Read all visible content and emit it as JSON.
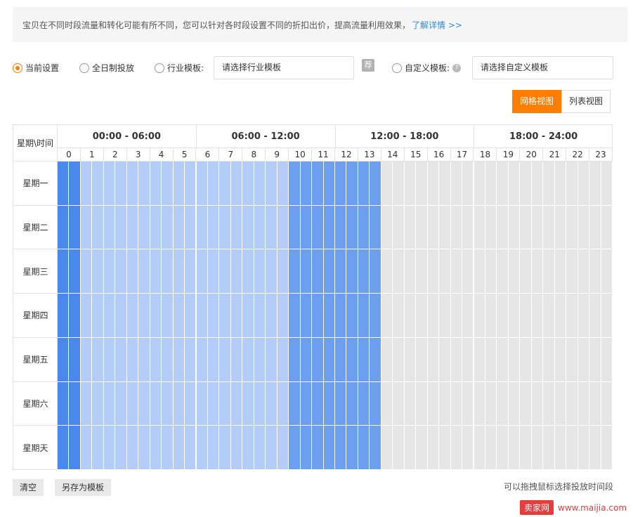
{
  "notice": {
    "text": "宝贝在不同时段流量和转化可能有所不同，您可以针对各时段设置不同的折扣出价，提高流量利用效果，",
    "link": "了解详情 >>"
  },
  "options": {
    "current": "当前设置",
    "all_day": "全日制投放",
    "industry_label": "行业模板:",
    "industry_placeholder": "请选择行业模板",
    "rec_icon": "荐",
    "custom_label": "自定义模板:",
    "custom_placeholder": "请选择自定义模板",
    "help_icon": "?"
  },
  "view": {
    "grid": "网格视图",
    "list": "列表视图"
  },
  "grid": {
    "corner": "星期\\时间",
    "blocks": [
      "00:00 - 06:00",
      "06:00 - 12:00",
      "12:00 - 18:00",
      "18:00 - 24:00"
    ],
    "hours": [
      "0",
      "1",
      "2",
      "3",
      "4",
      "5",
      "6",
      "7",
      "8",
      "9",
      "10",
      "11",
      "12",
      "13",
      "14",
      "15",
      "16",
      "17",
      "18",
      "19",
      "20",
      "21",
      "22",
      "23"
    ],
    "days": [
      "星期一",
      "星期二",
      "星期三",
      "星期四",
      "星期五",
      "星期六",
      "星期天"
    ],
    "half_hour_levels_weekday": [
      3,
      3,
      1,
      1,
      1,
      1,
      1,
      1,
      1,
      1,
      1,
      1,
      1,
      1,
      1,
      1,
      1,
      1,
      1,
      1,
      2,
      2,
      2,
      2,
      2,
      2,
      2,
      2,
      0,
      0,
      0,
      0,
      0,
      0,
      0,
      0,
      0,
      0,
      0,
      0,
      0,
      0,
      0,
      0,
      0,
      0,
      0,
      0,
      0,
      0,
      0,
      0,
      0,
      0,
      0,
      0,
      0,
      0,
      0,
      0,
      0,
      0,
      0,
      0,
      0,
      0,
      0,
      0,
      0,
      0,
      0,
      0,
      0,
      0,
      3,
      3,
      3,
      3,
      3,
      3,
      0,
      0,
      0,
      0,
      0,
      0,
      0,
      0,
      0,
      0,
      3,
      3
    ],
    "half_hour_levels_weekend": [
      3,
      3,
      1,
      1,
      1,
      1,
      1,
      1,
      1,
      1,
      1,
      1,
      1,
      1,
      1,
      1,
      1,
      1,
      1,
      1,
      2,
      2,
      2,
      2,
      2,
      2,
      2,
      2,
      0,
      0,
      0,
      0,
      0,
      0,
      0,
      0,
      0,
      0,
      0,
      0,
      0,
      0,
      0,
      0,
      0,
      0,
      0,
      0,
      0,
      0,
      0,
      0,
      0,
      0,
      0,
      0,
      0,
      0,
      0,
      0,
      0,
      0,
      0,
      0,
      0,
      0,
      0,
      0,
      0,
      0,
      0,
      0,
      0,
      0,
      4,
      4,
      4,
      4,
      4,
      4,
      0,
      0,
      0,
      0,
      0,
      0,
      0,
      0,
      0,
      0,
      3,
      3
    ],
    "level_colors": [
      "#e6e6e6",
      "#b3cdf8",
      "#6d9ff0",
      "#4a87ee",
      "#2c76ec"
    ]
  },
  "buttons": {
    "clear": "清空",
    "save_template": "另存为模板"
  },
  "hint": "可以拖拽鼠标选择投放时间段",
  "watermark": {
    "logo": "卖家网",
    "url": "www.maijia.com"
  }
}
